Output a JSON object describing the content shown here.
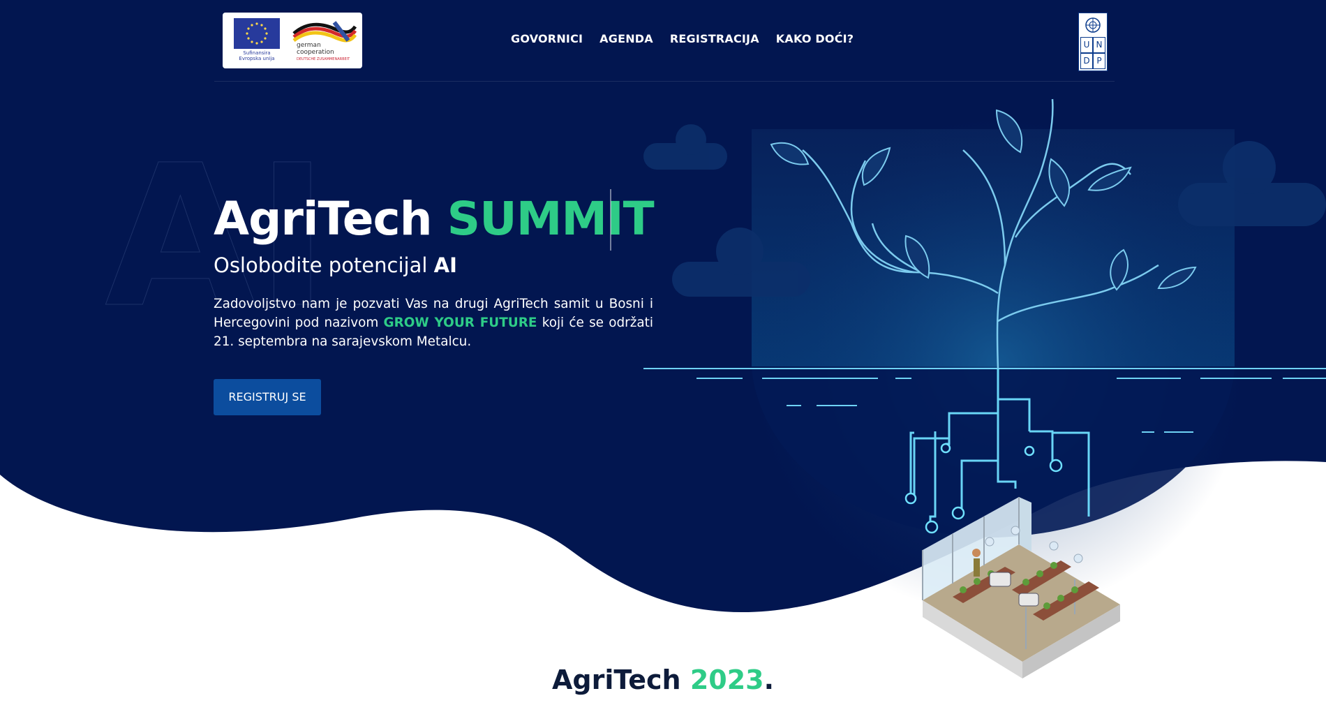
{
  "header": {
    "sponsor": {
      "eu_caption_line1": "Sufinansira",
      "eu_caption_line2": "Evropska unija",
      "partner_line1": "german",
      "partner_line2": "cooperation",
      "partner_sub": "DEUTSCHE ZUSAMMENARBEIT"
    },
    "nav": [
      "GOVORNICI",
      "AGENDA",
      "REGISTRACIJA",
      "KAKO DOĆI?"
    ],
    "undp_letters": [
      "U",
      "N",
      "D",
      "P"
    ]
  },
  "hero": {
    "watermark": "AI",
    "title_part1": "AgriTech ",
    "title_part2": "SUMMIT",
    "subtitle_part1": "Oslobodite potencijal ",
    "subtitle_part2": "AI",
    "para_part1": "Zadovoljstvo nam je pozvati Vas na drugi AgriTech samit u Bosni i Hercegovini pod nazivom ",
    "para_highlight": "GROW YOUR FUTURE",
    "para_part2": " koji će se održati 21. septembra na sarajevskom Metalcu.",
    "cta_label": "REGISTRUJ SE"
  },
  "section": {
    "title_part1": "AgriTech ",
    "title_part2": "2023",
    "title_part3": "."
  },
  "colors": {
    "navy": "#021650",
    "accent_green": "#2ecc87",
    "button_blue": "#0c4d9e",
    "glow_cyan": "#6fd3f5"
  }
}
